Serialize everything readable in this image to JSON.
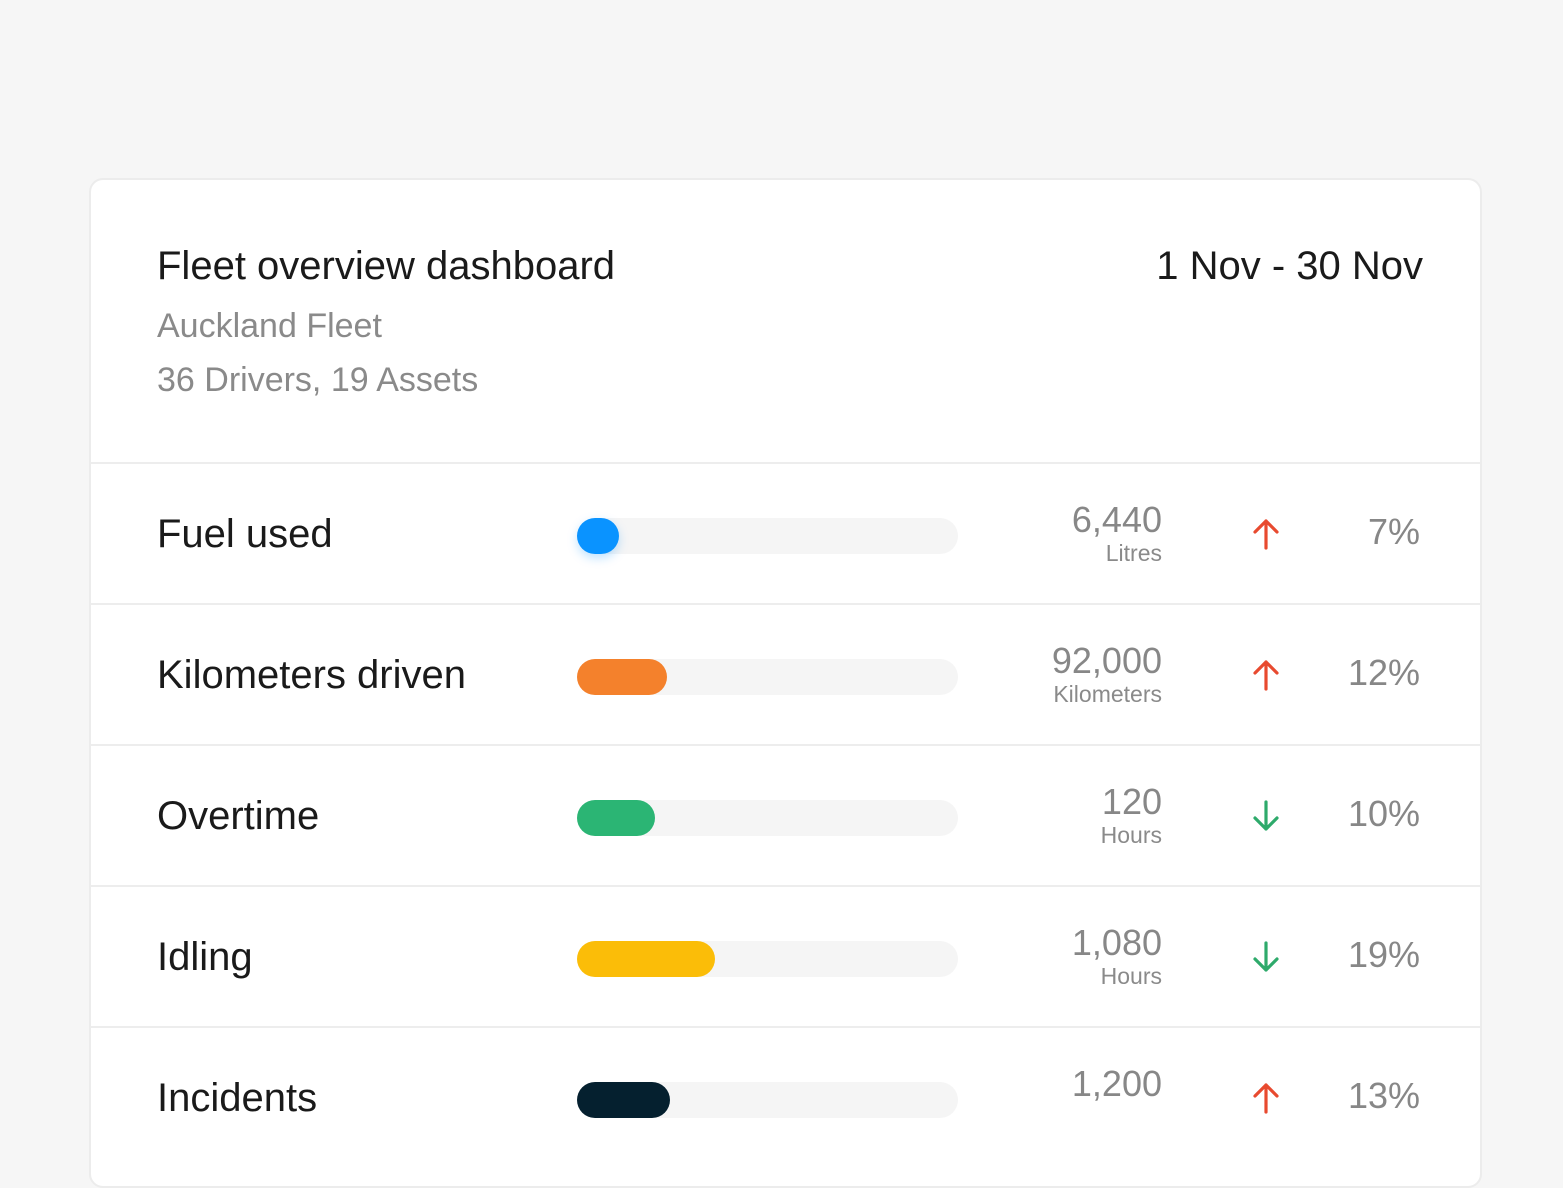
{
  "header": {
    "title": "Fleet overview dashboard",
    "subtitle": "Auckland Fleet",
    "meta": "36 Drivers, 19 Assets",
    "date_range": "1 Nov - 30 Nov"
  },
  "colors": {
    "up": "#e84a2f",
    "down": "#2eaa6b",
    "track": "#f5f5f5"
  },
  "metrics": [
    {
      "label": "Fuel used",
      "value": "6,440",
      "unit": "Litres",
      "trend": "up",
      "trend_icon": "arrow-up-icon",
      "percent": "7%",
      "bar_fraction": 0.11,
      "bar_color": "#0a93ff"
    },
    {
      "label": "Kilometers driven",
      "value": "92,000",
      "unit": "Kilometers",
      "trend": "up",
      "trend_icon": "arrow-up-icon",
      "percent": "12%",
      "bar_fraction": 0.236,
      "bar_color": "#f4812c"
    },
    {
      "label": "Overtime",
      "value": "120",
      "unit": "Hours",
      "trend": "down",
      "trend_icon": "arrow-down-icon",
      "percent": "10%",
      "bar_fraction": 0.205,
      "bar_color": "#2bb574"
    },
    {
      "label": "Idling",
      "value": "1,080",
      "unit": "Hours",
      "trend": "down",
      "trend_icon": "arrow-down-icon",
      "percent": "19%",
      "bar_fraction": 0.362,
      "bar_color": "#fbbd08"
    },
    {
      "label": "Incidents",
      "value": "1,200",
      "unit": "",
      "trend": "up",
      "trend_icon": "arrow-up-icon",
      "percent": "13%",
      "bar_fraction": 0.244,
      "bar_color": "#05202f"
    }
  ]
}
